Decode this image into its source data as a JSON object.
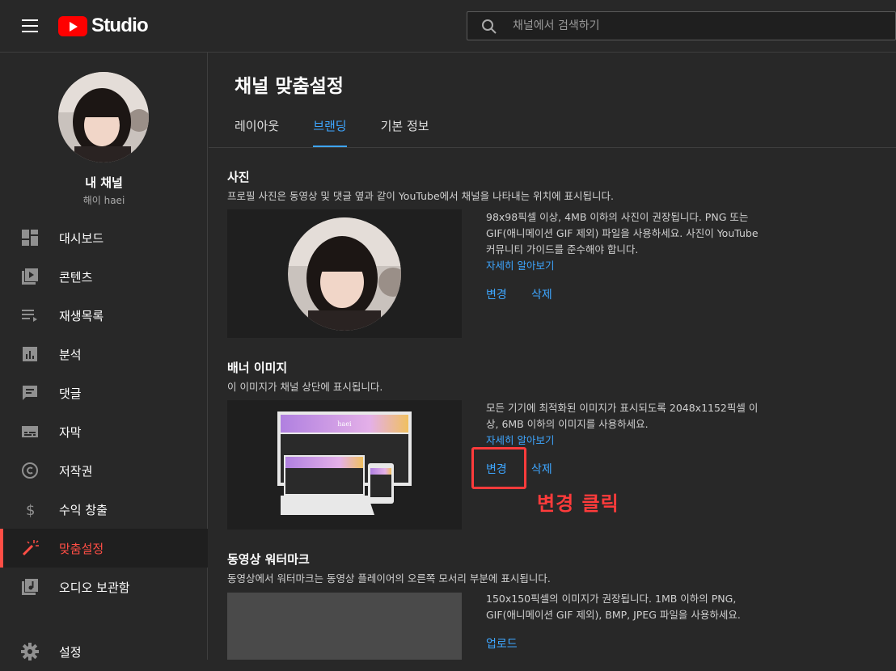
{
  "app": {
    "logo_text": "Studio",
    "brand_color": "#ff0000",
    "accent_color": "#3ea6ff",
    "active_color": "#ff4e45"
  },
  "search": {
    "placeholder": "채널에서 검색하기"
  },
  "channel": {
    "name": "내 채널",
    "handle": "해이 haei"
  },
  "sidebar": {
    "items": [
      {
        "label": "대시보드",
        "icon": "dashboard-icon"
      },
      {
        "label": "콘텐츠",
        "icon": "content-icon"
      },
      {
        "label": "재생목록",
        "icon": "playlist-icon"
      },
      {
        "label": "분석",
        "icon": "analytics-icon"
      },
      {
        "label": "댓글",
        "icon": "comments-icon"
      },
      {
        "label": "자막",
        "icon": "subtitles-icon"
      },
      {
        "label": "저작권",
        "icon": "copyright-icon"
      },
      {
        "label": "수익 창출",
        "icon": "dollar-icon"
      },
      {
        "label": "맞춤설정",
        "icon": "magic-wand-icon",
        "active": true
      },
      {
        "label": "오디오 보관함",
        "icon": "audio-library-icon"
      },
      {
        "label": "설정",
        "icon": "gear-icon"
      }
    ]
  },
  "page": {
    "title": "채널 맞춤설정",
    "tabs": [
      {
        "label": "레이아웃"
      },
      {
        "label": "브랜딩",
        "active": true
      },
      {
        "label": "기본 정보"
      }
    ]
  },
  "photo": {
    "title": "사진",
    "desc": "프로필 사진은 동영상 및 댓글 옆과 같이 YouTube에서 채널을 나타내는 위치에 표시됩니다.",
    "info": "98x98픽셀 이상, 4MB 이하의 사진이 권장됩니다. PNG 또는 GIF(애니메이션 GIF 제외) 파일을 사용하세요. 사진이 YouTube 커뮤니티 가이드를 준수해야 합니다.",
    "learn_more": "자세히 알아보기",
    "change": "변경",
    "delete": "삭제"
  },
  "banner": {
    "title": "배너 이미지",
    "desc": "이 이미지가 채널 상단에 표시됩니다.",
    "info": "모든 기기에 최적화된 이미지가 표시되도록 2048x1152픽셀 이상, 6MB 이하의 이미지를 사용하세요.",
    "learn_more": "자세히 알아보기",
    "change": "변경",
    "delete": "삭제",
    "mock_text": "haei"
  },
  "watermark": {
    "title": "동영상 워터마크",
    "desc": "동영상에서 워터마크는 동영상 플레이어의 오른쪽 모서리 부분에 표시됩니다.",
    "info": "150x150픽셀의 이미지가 권장됩니다. 1MB 이하의 PNG, GIF(애니메이션 GIF 제외), BMP, JPEG 파일을 사용하세요.",
    "upload": "업로드"
  },
  "annotation": {
    "text": "변경 클릭",
    "color": "#ff3b3b"
  }
}
